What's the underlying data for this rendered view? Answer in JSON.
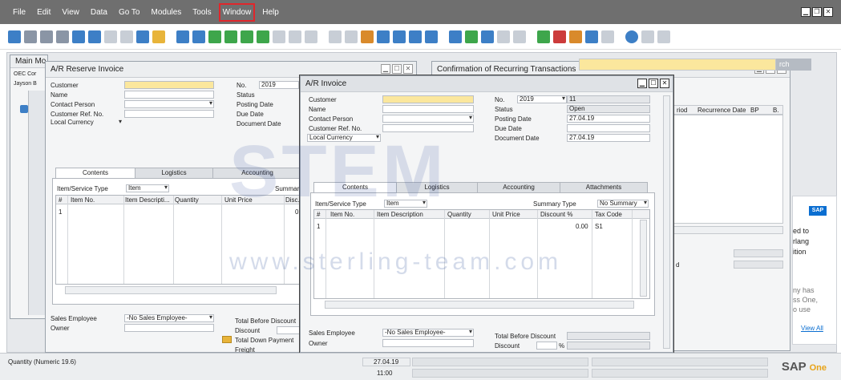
{
  "menu": [
    "File",
    "Edit",
    "View",
    "Data",
    "Go To",
    "Modules",
    "Tools",
    "Window",
    "Help"
  ],
  "menu_active": "Window",
  "main_menu": {
    "title": "Main Mo",
    "company": "OEC Cor",
    "user": "Jayson B"
  },
  "reserve_invoice": {
    "title": "A/R Reserve Invoice",
    "labels": {
      "customer": "Customer",
      "name": "Name",
      "contact_person": "Contact Person",
      "customer_ref": "Customer Ref. No.",
      "currency": "Local Currency",
      "no": "No.",
      "status": "Status",
      "posting_date": "Posting Date",
      "due_date": "Due Date",
      "document_date": "Document Date",
      "item_service_type": "Item/Service Type",
      "summary": "Summary",
      "sales_employee": "Sales Employee",
      "owner": "Owner",
      "total_before_discount": "Total Before Discount",
      "discount": "Discount",
      "total_down_payment": "Total Down Payment",
      "freight": "Freight"
    },
    "values": {
      "no": "2019",
      "item_type": "Item",
      "sales_employee": "-No Sales Employee-",
      "row1": "1",
      "disc_partial": "0.4"
    },
    "tabs": [
      "Contents",
      "Logistics",
      "Accounting"
    ],
    "columns": [
      "#",
      "Item No.",
      "Item Descripti...",
      "Quantity",
      "Unit Price",
      "Disc."
    ]
  },
  "recurring": {
    "title": "Confirmation of Recurring Transactions",
    "columns": [
      "riod",
      "Recurrence Date",
      "BP",
      "B."
    ],
    "search_btn": "rch",
    "row_label": "d"
  },
  "ar_invoice": {
    "title": "A/R Invoice",
    "labels": {
      "customer": "Customer",
      "name": "Name",
      "contact_person": "Contact Person",
      "customer_ref": "Customer Ref. No.",
      "currency": "Local Currency",
      "no": "No.",
      "status": "Status",
      "posting_date": "Posting Date",
      "due_date": "Due Date",
      "document_date": "Document Date",
      "item_service_type": "Item/Service Type",
      "summary_type": "Summary Type",
      "sales_employee": "Sales Employee",
      "owner": "Owner",
      "total_before_discount": "Total Before Discount",
      "discount": "Discount",
      "percent": "%"
    },
    "values": {
      "no_series": "2019",
      "doc_no": "11",
      "status": "Open",
      "posting_date": "27.04.19",
      "document_date": "27.04.19",
      "item_type": "Item",
      "summary_type": "No Summary",
      "sales_employee": "-No Sales Employee-",
      "row1": "1",
      "discount_pct": "0.00",
      "tax_code": "S1"
    },
    "tabs": [
      "Contents",
      "Logistics",
      "Accounting",
      "Attachments"
    ],
    "columns": [
      "#",
      "Item No.",
      "Item Description",
      "Quantity",
      "Unit Price",
      "Discount %",
      "Tax Code"
    ]
  },
  "sap_panel": {
    "badge": "SAP",
    "text_lines": [
      "ed to",
      "rlang",
      "ition"
    ],
    "text_lines2": [
      "ny has",
      "ss One,",
      "o use"
    ],
    "link": "View All"
  },
  "statusbar": {
    "message": "Quantity (Numeric 19.6)",
    "date": "27.04.19",
    "time": "11:00",
    "logo": "SAP",
    "logo_sub": "One"
  },
  "watermark": {
    "big": "STEM",
    "url": "www.sterling-team.com"
  },
  "colors": {
    "menubar": "#6f6f6f",
    "highlight": "#e0262b",
    "yellow_field": "#fbe79d",
    "sap_blue": "#0a6ed1"
  }
}
